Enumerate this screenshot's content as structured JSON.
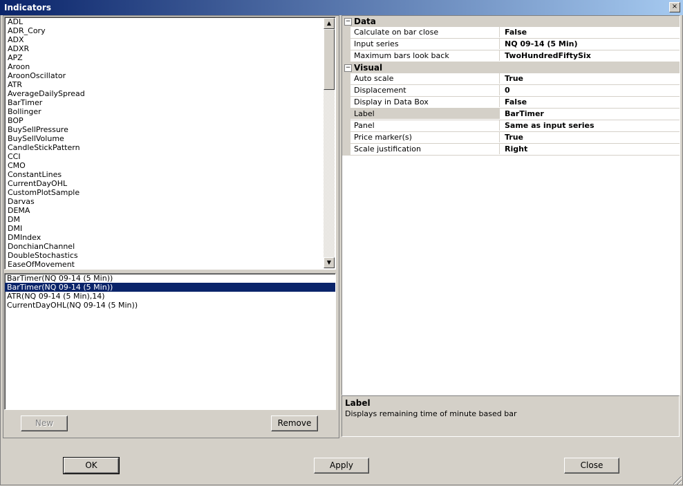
{
  "window": {
    "title": "Indicators",
    "close_glyph": "×"
  },
  "indicators": [
    "ADL",
    "ADR_Cory",
    "ADX",
    "ADXR",
    "APZ",
    "Aroon",
    "AroonOscillator",
    "ATR",
    "AverageDailySpread",
    "BarTimer",
    "Bollinger",
    "BOP",
    "BuySellPressure",
    "BuySellVolume",
    "CandleStickPattern",
    "CCI",
    "CMO",
    "ConstantLines",
    "CurrentDayOHL",
    "CustomPlotSample",
    "Darvas",
    "DEMA",
    "DM",
    "DMI",
    "DMIndex",
    "DonchianChannel",
    "DoubleStochastics",
    "EaseOfMovement"
  ],
  "active_indicators": [
    {
      "label": "BarTimer(NQ 09-14 (5 Min))",
      "selected": false
    },
    {
      "label": "BarTimer(NQ 09-14 (5 Min))",
      "selected": true
    },
    {
      "label": "ATR(NQ 09-14 (5 Min),14)",
      "selected": false
    },
    {
      "label": "CurrentDayOHL(NQ 09-14 (5 Min))",
      "selected": false
    }
  ],
  "scrollbar": {
    "up_glyph": "▲",
    "down_glyph": "▼"
  },
  "buttons": {
    "new": "New",
    "remove": "Remove",
    "ok": "OK",
    "apply": "Apply",
    "close": "Close"
  },
  "properties": {
    "categories": [
      {
        "name": "Data",
        "toggle": "−",
        "rows": [
          {
            "name": "Calculate on bar close",
            "value": "False"
          },
          {
            "name": "Input series",
            "value": "NQ 09-14 (5 Min)"
          },
          {
            "name": "Maximum bars look back",
            "value": "TwoHundredFiftySix"
          }
        ]
      },
      {
        "name": "Visual",
        "toggle": "−",
        "rows": [
          {
            "name": "Auto scale",
            "value": "True"
          },
          {
            "name": "Displacement",
            "value": "0"
          },
          {
            "name": "Display in Data Box",
            "value": "False"
          },
          {
            "name": "Label",
            "value": "BarTimer",
            "selected": true
          },
          {
            "name": "Panel",
            "value": "Same as input series"
          },
          {
            "name": "Price marker(s)",
            "value": "True"
          },
          {
            "name": "Scale justification",
            "value": "Right"
          }
        ]
      }
    ]
  },
  "description": {
    "title": "Label",
    "text": "Displays remaining time of minute based bar"
  }
}
